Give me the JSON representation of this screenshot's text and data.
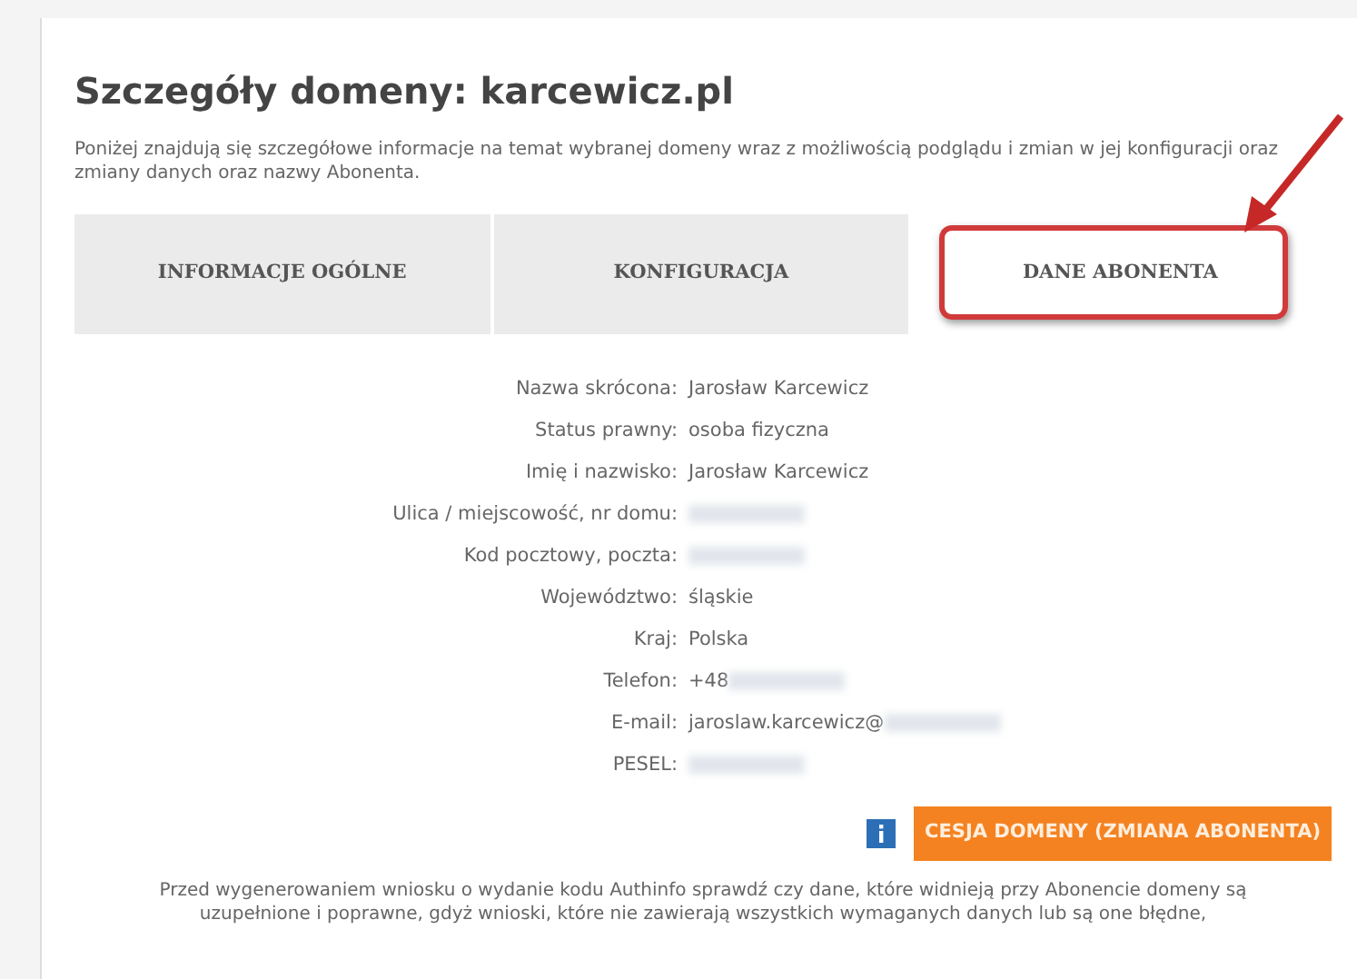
{
  "title": "Szczegóły domeny: karcewicz.pl",
  "description": "Poniżej znajdują się szczegółowe informacje na temat wybranej domeny wraz z możliwością podglądu i zmian w jej konfiguracji oraz zmiany danych oraz nazwy Abonenta.",
  "tabs": [
    {
      "label": "INFORMACJE OGÓLNE",
      "selected": false,
      "highlighted": false
    },
    {
      "label": "KONFIGURACJA",
      "selected": false,
      "highlighted": false
    },
    {
      "label": "DANE ABONENTA",
      "selected": true,
      "highlighted": true
    }
  ],
  "details": [
    {
      "label": "Nazwa skrócona:",
      "value": "Jarosław Karcewicz"
    },
    {
      "label": "Status prawny:",
      "value": "osoba fizyczna"
    },
    {
      "label": "Imię i nazwisko:",
      "value": "Jarosław Karcewicz"
    },
    {
      "label": "Ulica / miejscowość, nr domu:",
      "blurred": true
    },
    {
      "label": "Kod pocztowy, poczta:",
      "blurred": true
    },
    {
      "label": "Województwo:",
      "value": "śląskie"
    },
    {
      "label": "Kraj:",
      "value": "Polska"
    },
    {
      "label": "Telefon:",
      "value": "+48",
      "blurred": true
    },
    {
      "label": "E-mail:",
      "value": "jaroslaw.karcewicz@",
      "blurred": true
    },
    {
      "label": "PESEL:",
      "blurred": true
    }
  ],
  "transfer_button": "CESJA DOMENY (ZMIANA ABONENTA)",
  "notice": "Przed wygenerowaniem wniosku o wydanie kodu Authinfo sprawdź czy dane, które widnieją przy Abonencie domeny są uzupełnione i poprawne, gdyż wnioski, które nie zawierają wszystkich wymaganych danych lub są one błędne,"
}
